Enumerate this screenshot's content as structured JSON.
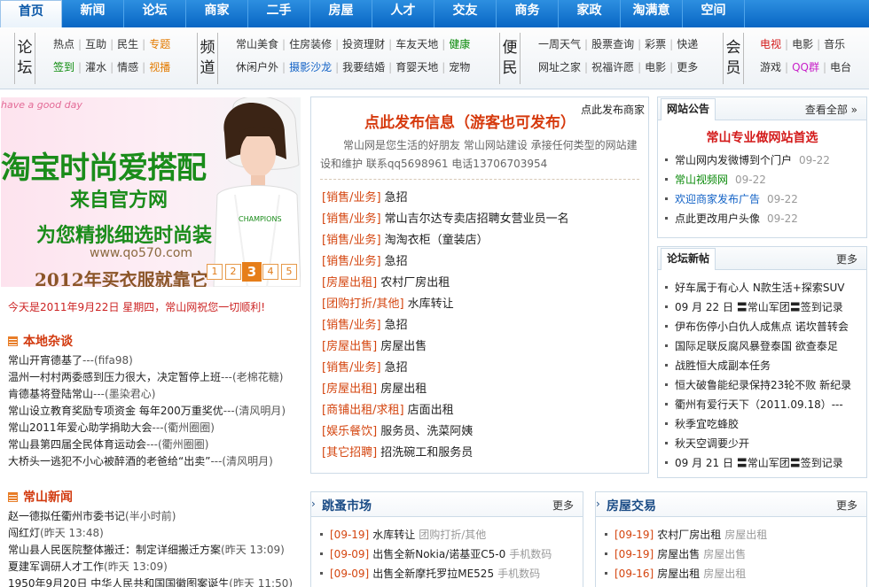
{
  "top_nav": [
    "首页",
    "新闻",
    "论坛",
    "商家",
    "二手",
    "房屋",
    "人才",
    "交友",
    "商务",
    "家政",
    "淘满意",
    "空间"
  ],
  "categories": {
    "forum": {
      "label": [
        "论",
        "坛"
      ],
      "rows": [
        [
          {
            "t": "热点"
          },
          {
            "t": "互助"
          },
          {
            "t": "民生"
          },
          {
            "t": "专题",
            "c": "o"
          }
        ],
        [
          {
            "t": "签到",
            "c": "g"
          },
          {
            "t": "灌水"
          },
          {
            "t": "情感"
          },
          {
            "t": "视播",
            "c": "o"
          }
        ]
      ]
    },
    "channel": {
      "label": [
        "频",
        "道"
      ],
      "rows": [
        [
          {
            "t": "常山美食"
          },
          {
            "t": "住房装修"
          },
          {
            "t": "投资理财"
          },
          {
            "t": "车友天地"
          },
          {
            "t": "健康",
            "c": "g"
          }
        ],
        [
          {
            "t": "休闲户外"
          },
          {
            "t": "摄影沙龙",
            "c": "b"
          },
          {
            "t": "我要结婚"
          },
          {
            "t": "育婴天地"
          },
          {
            "t": "宠物"
          }
        ]
      ]
    },
    "service": {
      "label": [
        "便",
        "民"
      ],
      "rows": [
        [
          {
            "t": "一周天气"
          },
          {
            "t": "股票查询"
          },
          {
            "t": "彩票"
          },
          {
            "t": "快递"
          }
        ],
        [
          {
            "t": "网址之家"
          },
          {
            "t": "祝福许愿"
          },
          {
            "t": "电影"
          },
          {
            "t": "更多"
          }
        ]
      ]
    },
    "member": {
      "label": [
        "会",
        "员"
      ],
      "rows": [
        [
          {
            "t": "电视",
            "c": "r"
          },
          {
            "t": "电影"
          },
          {
            "t": "音乐"
          }
        ],
        [
          {
            "t": "游戏"
          },
          {
            "t": "QQ群",
            "c": "pk"
          },
          {
            "t": "电台"
          }
        ]
      ]
    }
  },
  "banner": {
    "tag": "have a good day",
    "title": "淘宝时尚爱搭配",
    "subtitle": "来自官方网",
    "line": "为您精挑细选时尚装",
    "url": "www.qo570.com",
    "footer": "2012年买衣服就靠它",
    "pages": [
      "1",
      "2",
      "3",
      "4",
      "5"
    ],
    "active_page": "3",
    "shirt_text": "CHAMPIONS"
  },
  "date_line": "今天是2011年9月22日 星期四，常山网祝您一切顺利!",
  "local_news": {
    "title": "本地杂谈",
    "items": [
      {
        "t": "常山开宵德基了",
        "s": "---(fifa98)"
      },
      {
        "t": "温州一村村两委感到压力很大，决定暂停上班",
        "s": "---(老棉花糖)"
      },
      {
        "t": "肯德基将登陆常山",
        "s": "---(墨染君心)"
      },
      {
        "t": "常山设立教育奖励专项资金 每年200万重奖优",
        "s": "---(清风明月)"
      },
      {
        "t": "常山2011年爱心助学捐助大会",
        "s": "---(衢州圈圈)"
      },
      {
        "t": "常山县第四届全民体育运动会",
        "s": "---(衢州圈圈)"
      },
      {
        "t": "大桥头一逃犯不小心被醉酒的老爸给“出卖”",
        "s": "---(清风明月)"
      }
    ]
  },
  "cs_news": {
    "title": "常山新闻",
    "items": [
      {
        "t": "赵一德拟任衢州市委书记",
        "s": "(半小时前)"
      },
      {
        "t": "闯红灯",
        "s": "(昨天 13:48)"
      },
      {
        "t": "常山县人民医院整体搬迁：制定详细搬迁方案",
        "s": "(昨天 13:09)"
      },
      {
        "t": "夏建军调研人才工作",
        "s": "(昨天 13:09)"
      },
      {
        "t": "1950年9月20日 中华人民共和国国徽图案诞生",
        "s": "(昨天 11:50)"
      }
    ]
  },
  "publish": {
    "title": "点此发布信息（游客也可发布）",
    "biz_link": "点此发布商家",
    "intro": "常山网是您生活的好朋友 常山网站建设 承接任何类型的网站建设和维护 联系qq5698961 电话13706703954",
    "ads": [
      {
        "c": "[销售/业务]",
        "t": "急招"
      },
      {
        "c": "[销售/业务]",
        "t": "常山吉尔达专卖店招聘女营业员一名"
      },
      {
        "c": "[销售/业务]",
        "t": "淘淘衣柜（童装店）"
      },
      {
        "c": "[销售/业务]",
        "t": "急招"
      },
      {
        "c": "[房屋出租]",
        "t": "农村厂房出租"
      },
      {
        "c": "[团购打折/其他]",
        "t": "水库转让"
      },
      {
        "c": "[销售/业务]",
        "t": "急招"
      },
      {
        "c": "[房屋出售]",
        "t": "房屋出售"
      },
      {
        "c": "[销售/业务]",
        "t": "急招"
      },
      {
        "c": "[房屋出租]",
        "t": "房屋出租"
      },
      {
        "c": "[商铺出租/求租]",
        "t": "店面出租"
      },
      {
        "c": "[娱乐餐饮]",
        "t": "服务员、洗菜阿姨"
      },
      {
        "c": "[其它招聘]",
        "t": "招洗碗工和服务员"
      }
    ]
  },
  "notice": {
    "tab": "网站公告",
    "more": "查看全部 »",
    "headline": "常山专业做网站首选",
    "items": [
      {
        "t": "常山网内发微博到个门户",
        "d": "09-22",
        "c": ""
      },
      {
        "t": "常山视频网",
        "d": "09-22",
        "c": "g"
      },
      {
        "t": "欢迎商家发布广告",
        "d": "09-22",
        "c": "b"
      },
      {
        "t": "点此更改用户头像",
        "d": "09-22",
        "c": ""
      }
    ]
  },
  "forum_posts": {
    "tab": "论坛新帖",
    "more": "更多",
    "items": [
      "好车属于有心人 N款生活+探索SUV",
      "09 月 22 日 〓常山军团〓签到记录",
      "伊布伤停小白仇人成焦点 诺坎普转会",
      "国际足联反腐风暴登泰国 欲查泰足",
      "战胜恒大成副本任务",
      "恒大破鲁能纪录保持23轮不败 新纪录",
      "衢州有爱行天下（2011.09.18）---",
      "秋季宜吃蜂胶",
      "秋天空调要少开",
      "09 月 21 日 〓常山军团〓签到记录"
    ]
  },
  "flea": {
    "title": "跳蚤市场",
    "more": "更多",
    "items": [
      {
        "d": "[09-19]",
        "t": "水库转让",
        "c": "团购打折/其他"
      },
      {
        "d": "[09-09]",
        "t": "出售全新Nokia/诺基亚C5-0",
        "c": "手机数码"
      },
      {
        "d": "[09-09]",
        "t": "出售全新摩托罗拉ME525",
        "c": "手机数码"
      }
    ]
  },
  "house": {
    "title": "房屋交易",
    "more": "更多",
    "items": [
      {
        "d": "[09-19]",
        "t": "农村厂房出租",
        "c": "房屋出租"
      },
      {
        "d": "[09-19]",
        "t": "房屋出售",
        "c": "房屋出售"
      },
      {
        "d": "[09-16]",
        "t": "房屋出租",
        "c": "房屋出租"
      }
    ]
  },
  "colors": {
    "nav": "#0b6fd1",
    "accent": "#d63a0e",
    "link": "#1262c6",
    "green": "#0a8a0a"
  }
}
